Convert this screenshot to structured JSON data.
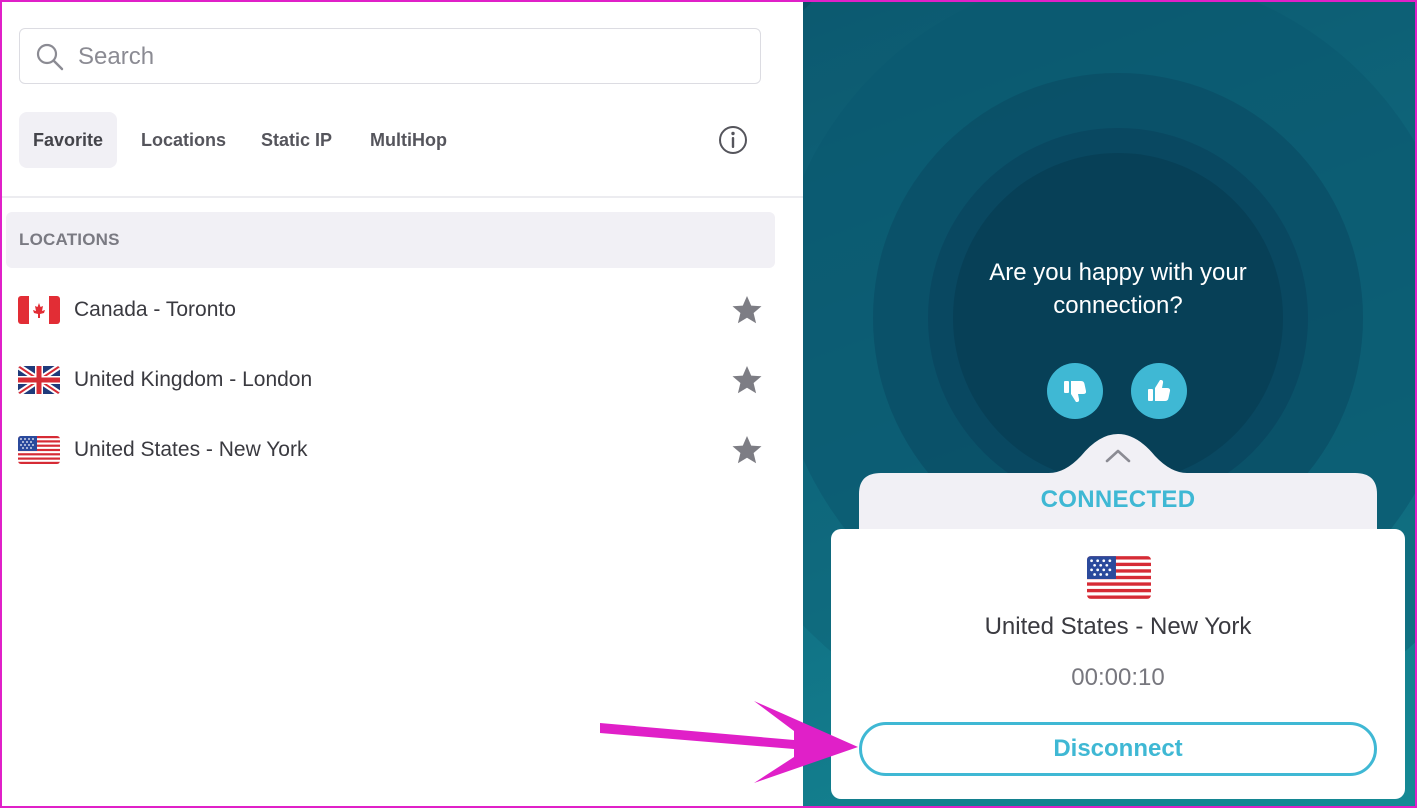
{
  "search": {
    "placeholder": "Search",
    "value": ""
  },
  "tabs": [
    {
      "label": "Favorite",
      "active": true
    },
    {
      "label": "Locations",
      "active": false
    },
    {
      "label": "Static IP",
      "active": false
    },
    {
      "label": "MultiHop",
      "active": false
    }
  ],
  "info_icon": "info-icon",
  "locations": {
    "header": "LOCATIONS",
    "items": [
      {
        "name": "Canada - Toronto",
        "flag": "canada-flag",
        "favorite": true
      },
      {
        "name": "United Kingdom - London",
        "flag": "uk-flag",
        "favorite": true
      },
      {
        "name": "United States - New York",
        "flag": "us-flag",
        "favorite": true
      }
    ]
  },
  "feedback": {
    "question": "Are you happy with your connection?",
    "thumbs_down_icon": "thumbs-down-icon",
    "thumbs_up_icon": "thumbs-up-icon"
  },
  "connection": {
    "status": "CONNECTED",
    "location": "United States - New York",
    "flag": "us-flag",
    "timer": "00:00:10",
    "disconnect_label": "Disconnect"
  },
  "colors": {
    "accent": "#3fb8d4",
    "panel_dark": "#0b4d66",
    "panel_light": "#158a95",
    "annotation": "#e020c8",
    "star": "#7d7d84"
  }
}
